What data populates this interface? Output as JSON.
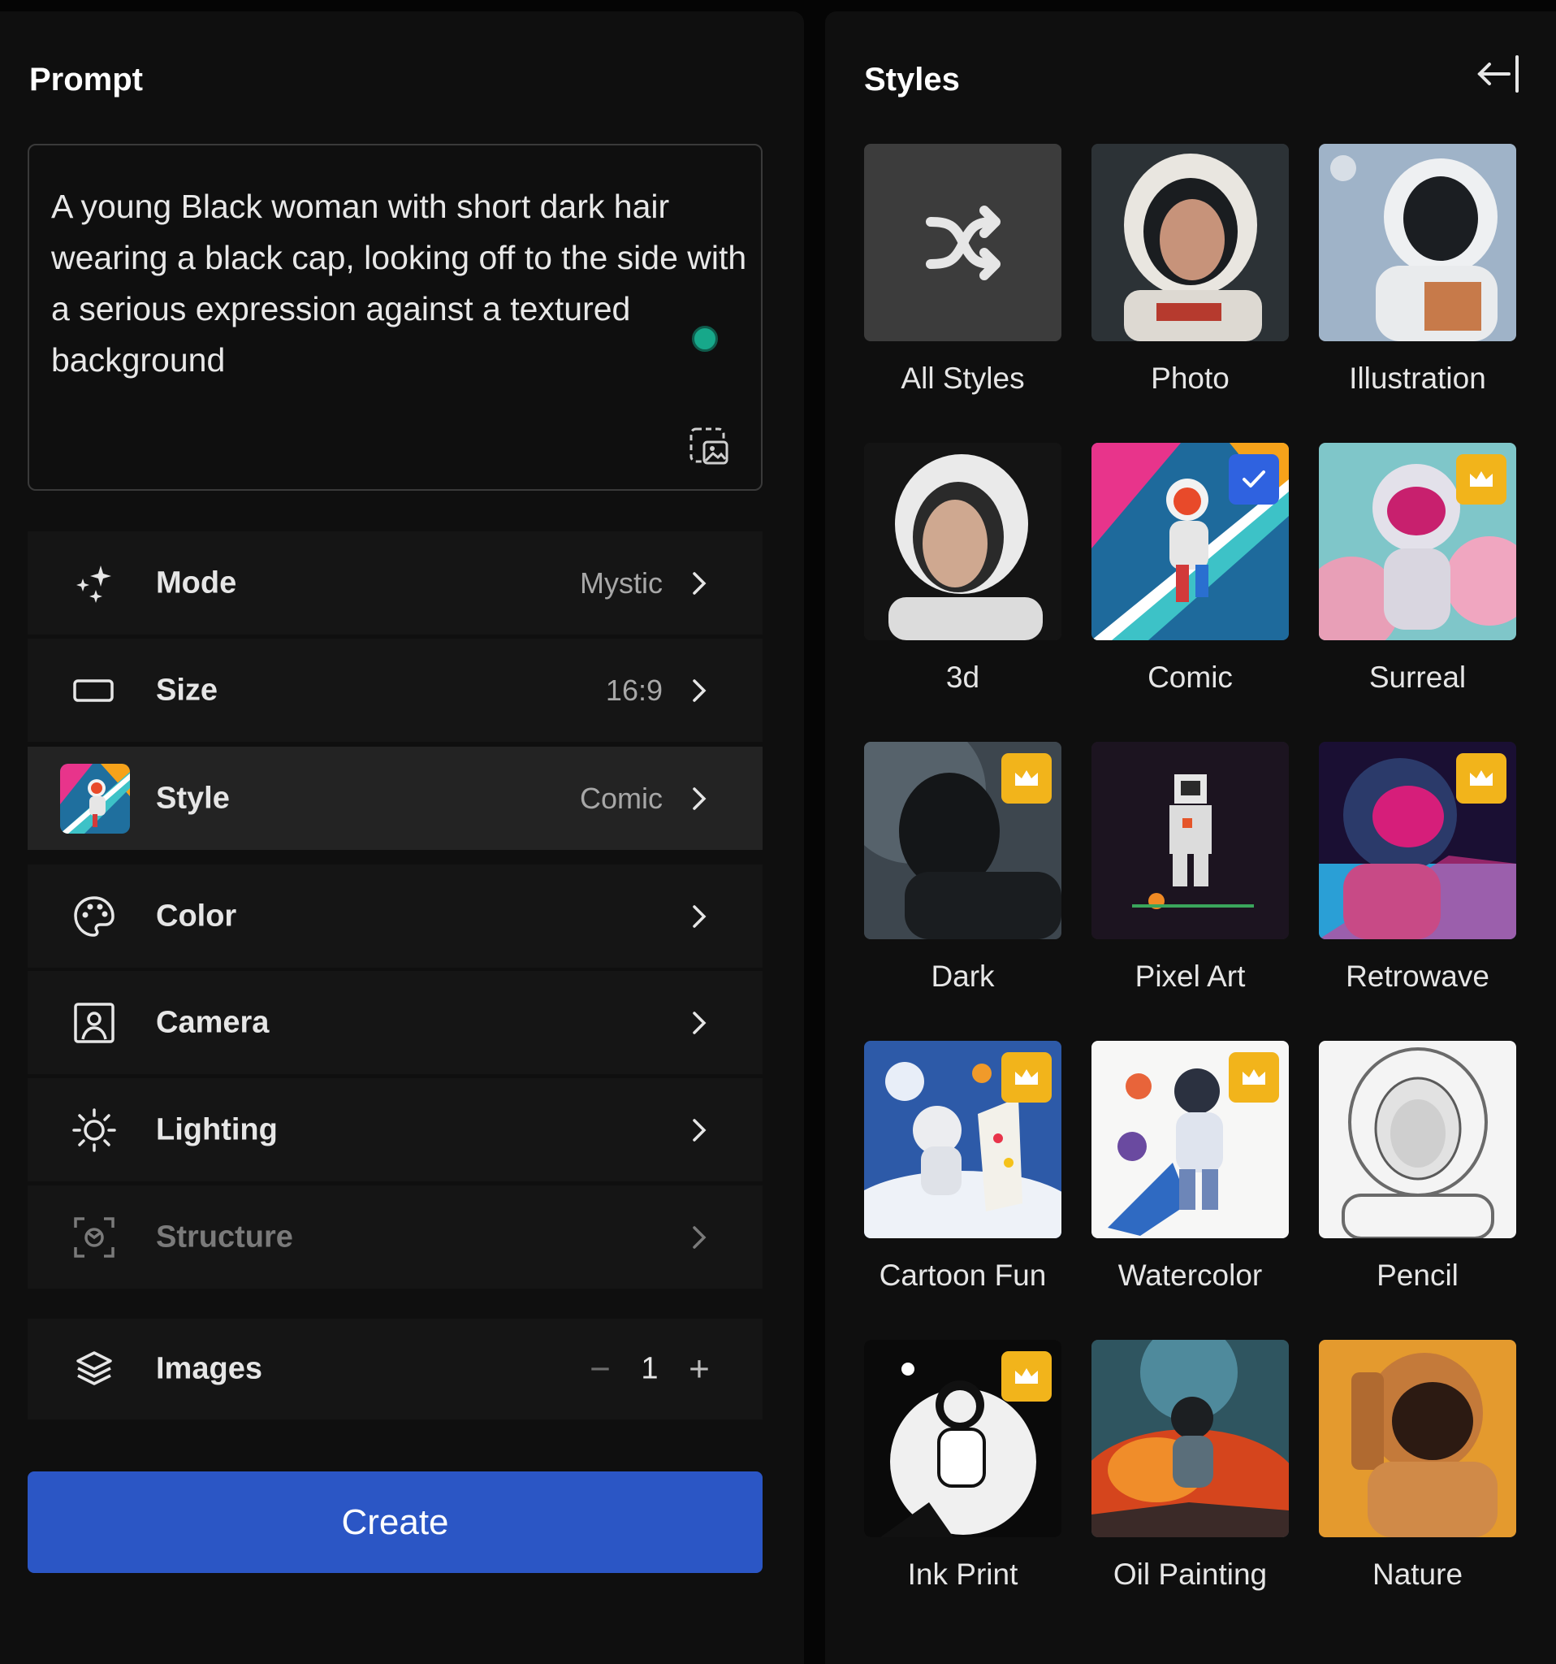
{
  "prompt_panel": {
    "title": "Prompt",
    "prompt_text": "A young Black woman with short dark hair wearing a black cap, looking off to the side with a serious expression against a textured background"
  },
  "options": [
    {
      "label": "Mode",
      "value": "Mystic",
      "icon": "sparkles-icon"
    },
    {
      "label": "Size",
      "value": "16:9",
      "icon": "aspect-ratio-icon"
    },
    {
      "label": "Style",
      "value": "Comic",
      "icon": "style-thumbnail"
    },
    {
      "label": "Color",
      "value": "",
      "icon": "palette-icon"
    },
    {
      "label": "Camera",
      "value": "",
      "icon": "portrait-icon"
    },
    {
      "label": "Lighting",
      "value": "",
      "icon": "sun-icon"
    },
    {
      "label": "Structure",
      "value": "",
      "icon": "structure-icon",
      "disabled": true
    }
  ],
  "images": {
    "label": "Images",
    "count": "1",
    "minus": "−",
    "plus": "+"
  },
  "create_label": "Create",
  "styles_panel": {
    "title": "Styles",
    "items": [
      {
        "name": "All Styles",
        "badge": ""
      },
      {
        "name": "Photo",
        "badge": ""
      },
      {
        "name": "Illustration",
        "badge": ""
      },
      {
        "name": "3d",
        "badge": ""
      },
      {
        "name": "Comic",
        "badge": "selected"
      },
      {
        "name": "Surreal",
        "badge": "premium"
      },
      {
        "name": "Dark",
        "badge": "premium"
      },
      {
        "name": "Pixel Art",
        "badge": ""
      },
      {
        "name": "Retrowave",
        "badge": "premium"
      },
      {
        "name": "Cartoon Fun",
        "badge": "premium"
      },
      {
        "name": "Watercolor",
        "badge": "premium"
      },
      {
        "name": "Pencil",
        "badge": ""
      },
      {
        "name": "Ink Print",
        "badge": "premium"
      },
      {
        "name": "Oil Painting",
        "badge": ""
      },
      {
        "name": "Nature",
        "badge": ""
      }
    ]
  },
  "colors": {
    "accent": "#2b56c5",
    "premium": "#f2b41b",
    "selected": "#2f62e0",
    "panel": "#0f0f0f"
  }
}
